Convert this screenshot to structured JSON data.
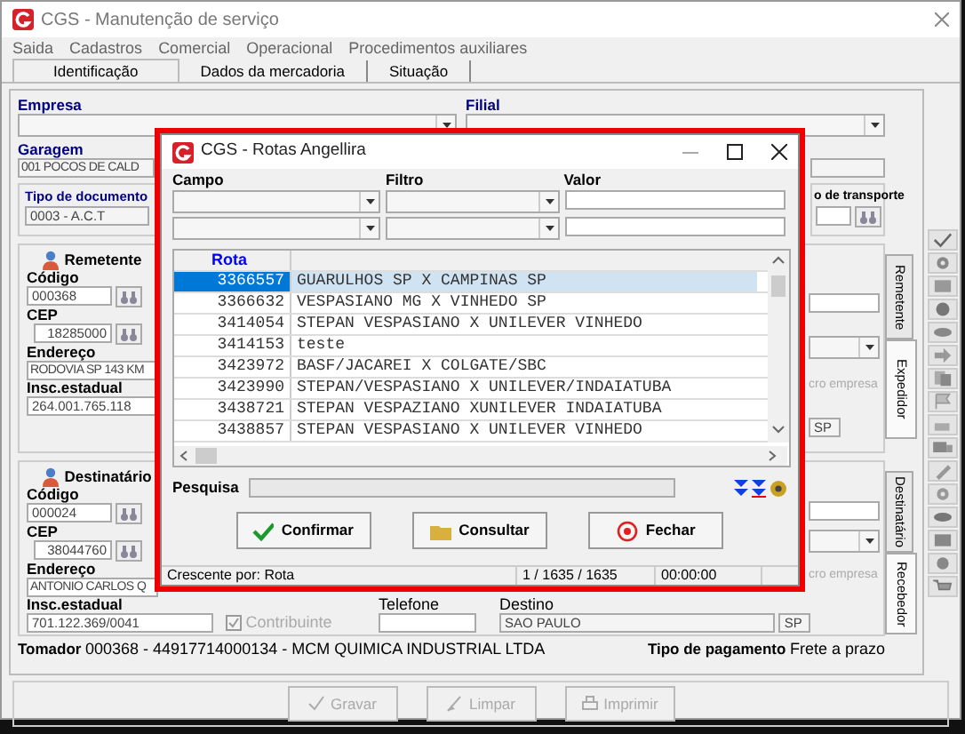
{
  "window": {
    "title": "CGS - Manutenção de serviço"
  },
  "menu": [
    "Saida",
    "Cadastros",
    "Comercial",
    "Operacional",
    "Procedimentos auxiliares"
  ],
  "tabs": [
    {
      "label": "Identificação",
      "selected": true
    },
    {
      "label": "Dados da mercadoria",
      "selected": false
    },
    {
      "label": "Situação",
      "selected": false
    }
  ],
  "empresa": {
    "label": "Empresa"
  },
  "filial": {
    "label": "Filial"
  },
  "garagem": {
    "label": "Garagem",
    "value": "001 POCOS DE CALD"
  },
  "tipo_documento": {
    "label": "Tipo de documento",
    "value": "0003 - A.C.T"
  },
  "tipo_transporte": {
    "label": "o de transporte"
  },
  "remetente": {
    "title": "Remetente",
    "codigo_label": "Código",
    "codigo": "000368",
    "cep_label": "CEP",
    "cep": "18285000",
    "endereco_label": "Endereço",
    "endereco": "RODOVIA SP 143 KM",
    "insc_label": "Insc.estadual",
    "insc": "264.001.765.118",
    "side_note": "cro empresa",
    "uf": "SP"
  },
  "remetente_tabs": [
    {
      "label": "Remetente",
      "selected": false
    },
    {
      "label": "Expedidor",
      "selected": true
    }
  ],
  "destinatario": {
    "title": "Destinatário",
    "codigo_label": "Código",
    "codigo": "000024",
    "cep_label": "CEP",
    "cep": "38044760",
    "endereco_label": "Endereço",
    "endereco": "ANTONIO CARLOS Q",
    "insc_label": "Insc.estadual",
    "insc": "701.122.369/0041",
    "contribuinte": {
      "label": "Contribuinte",
      "checked": true,
      "disabled": true
    },
    "telefone_label": "Telefone",
    "side_note": "cro empresa",
    "destino_label": "Destino",
    "destino": "SAO PAULO",
    "uf": "SP"
  },
  "destinatario_tabs": [
    {
      "label": "Destinatário",
      "selected": false
    },
    {
      "label": "Recebedor",
      "selected": true
    }
  ],
  "tomador": {
    "label": "Tomador",
    "value": "000368 - 44917714000134 - MCM QUIMICA INDUSTRIAL LTDA"
  },
  "pagamento": {
    "label": "Tipo de pagamento",
    "value": "Frete a prazo"
  },
  "buttons": [
    {
      "label": "Gravar",
      "kind": "save",
      "disabled": true
    },
    {
      "label": "Limpar",
      "kind": "clear",
      "disabled": true
    },
    {
      "label": "Imprimir",
      "kind": "print",
      "disabled": true
    }
  ],
  "dialog": {
    "title": "CGS - Rotas Angellira",
    "filter_headers": [
      "Campo",
      "Filtro",
      "Valor"
    ],
    "grid": {
      "column": "Rota",
      "rows": [
        {
          "code": "3366557",
          "name": "GUARULHOS SP X CAMPINAS SP",
          "selected": true
        },
        {
          "code": "3366632",
          "name": "VESPASIANO MG X VINHEDO SP",
          "selected": false
        },
        {
          "code": "3414054",
          "name": "STEPAN VESPASIANO X UNILEVER VINHEDO",
          "selected": false
        },
        {
          "code": "3414153",
          "name": "teste",
          "selected": false
        },
        {
          "code": "3423972",
          "name": "BASF/JACAREI X COLGATE/SBC",
          "selected": false
        },
        {
          "code": "3423990",
          "name": "STEPAN/VESPASIANO X UNILEVER/INDAIATUBA",
          "selected": false
        },
        {
          "code": "3438721",
          "name": "STEPAN VESPAZIANO XUNILEVER INDAIATUBA",
          "selected": false
        },
        {
          "code": "3438857",
          "name": "STEPAN VESPASIANO X UNILEVER VINHEDO",
          "selected": false
        }
      ]
    },
    "search_label": "Pesquisa",
    "buttons": [
      {
        "label": "Confirmar",
        "kind": "confirm"
      },
      {
        "label": "Consultar",
        "kind": "query"
      },
      {
        "label": "Fechar",
        "kind": "close"
      }
    ],
    "status": [
      "Crescente por: Rota",
      "1 / 1635 / 1635",
      "00:00:00"
    ]
  }
}
